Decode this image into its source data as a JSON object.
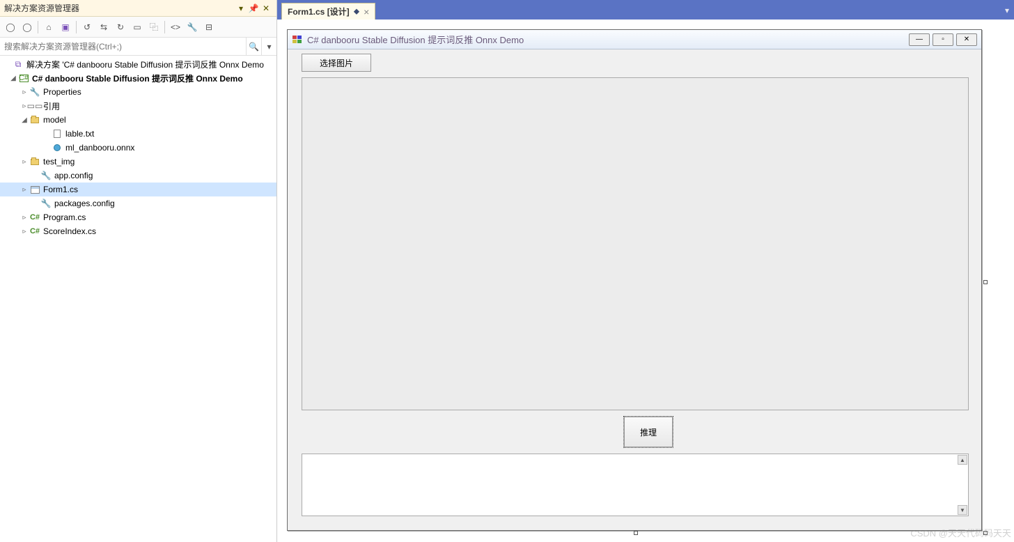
{
  "solution_explorer": {
    "title": "解决方案资源管理器",
    "search_placeholder": "搜索解决方案资源管理器(Ctrl+;)",
    "tree": {
      "solution": "解决方案 'C# danbooru Stable Diffusion 提示词反推 Onnx Demo",
      "project": "C# danbooru Stable Diffusion 提示词反推 Onnx Demo",
      "properties": "Properties",
      "references": "引用",
      "model_folder": "model",
      "lable_txt": "lable.txt",
      "ml_onnx": "ml_danbooru.onnx",
      "test_img": "test_img",
      "app_config": "app.config",
      "form1": "Form1.cs",
      "packages_config": "packages.config",
      "program_cs": "Program.cs",
      "scoreindex_cs": "ScoreIndex.cs"
    }
  },
  "tabs": {
    "active": "Form1.cs [设计]",
    "modified": "⬥"
  },
  "form": {
    "title": "C# danbooru Stable Diffusion 提示词反推 Onnx Demo",
    "btn_select_image": "选择图片",
    "btn_infer": "推理"
  },
  "watermark": "CSDN @天天代码码天天"
}
